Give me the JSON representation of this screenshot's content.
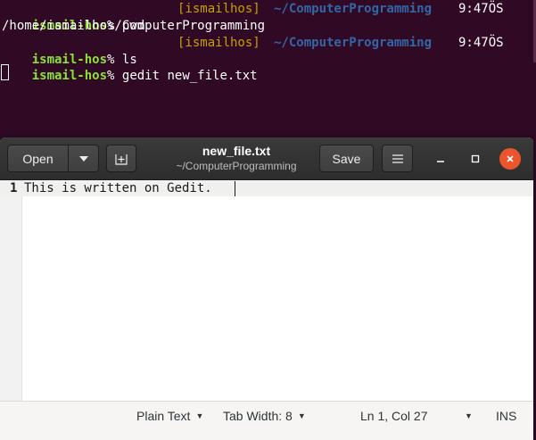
{
  "terminal": {
    "lines": [
      {
        "user": "ismail-hos",
        "prompt": "%",
        "command": "pwd",
        "bracket": "[ismailhos]",
        "dir": "~/ComputerProgramming",
        "time": "9:47ÖS"
      },
      {
        "output": "/home/ismailhos/ComputerProgramming"
      },
      {
        "user": "ismail-hos",
        "prompt": "%",
        "command": "ls",
        "bracket": "[ismailhos]",
        "dir": "~/ComputerProgramming",
        "time": "9:47ÖS"
      },
      {
        "user": "ismail-hos",
        "prompt": "%",
        "command": "gedit new_file.txt"
      }
    ],
    "colors": {
      "background": "#300a24",
      "user": "#8ae234",
      "bracket": "#c4a000",
      "dir": "#3465a4"
    }
  },
  "gedit": {
    "header": {
      "open_label": "Open",
      "save_label": "Save",
      "title": "new_file.txt",
      "subtitle": "~/ComputerProgramming"
    },
    "editor": {
      "line_number": "1",
      "line_text": "This is written on Gedit."
    },
    "statusbar": {
      "language": "Plain Text",
      "tab_width": "Tab Width: 8",
      "position": "Ln 1, Col 27",
      "mode": "INS"
    },
    "icons": {
      "open_menu": "chevron-down-icon",
      "new_tab": "new-tab-icon",
      "menu": "hamburger-icon",
      "minimize": "minimize-icon",
      "maximize": "maximize-icon",
      "close": "close-icon"
    }
  }
}
